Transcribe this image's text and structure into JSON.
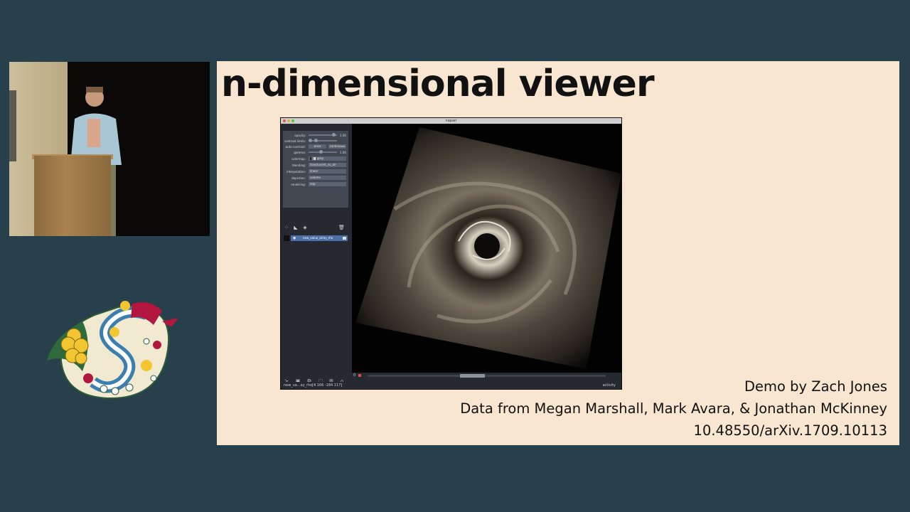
{
  "slide": {
    "title": "n-dimensional viewer",
    "credits": [
      "Demo by Zach Jones",
      "Data from Megan Marshall, Mark Avara, & Jonathan McKinney",
      "10.48550/arXiv.1709.10113"
    ]
  },
  "napari": {
    "window_title": "napari",
    "controls": {
      "opacity_label": "opacity:",
      "opacity_value": "1.00",
      "opacity_level": 0.95,
      "contrast_label": "contrast limits:",
      "auto_contrast_label": "auto-contrast:",
      "once_label": "once",
      "continuous_label": "continuous",
      "gamma_label": "gamma:",
      "gamma_value": "1.00",
      "colormap_label": "colormap:",
      "colormap_value": "gray",
      "blending_label": "blending:",
      "blending_value": "translucent_no_de",
      "interpolation_label": "interpolation:",
      "interpolation_value": "linear",
      "depiction_label": "depiction:",
      "depiction_value": "volume",
      "rendering_label": "rendering:",
      "rendering_value": "mip"
    },
    "layer_name": "new_value_array_rho",
    "status_layer": "new_va...ay_rho",
    "status_coords": "[4 166 -184 117]",
    "activity_label": "activity"
  },
  "colors": {
    "background": "#27404c",
    "slide_bg": "#f9e6d0",
    "napari_panel": "#262930",
    "napari_controls": "#414851",
    "napari_selected": "#4d6fa8"
  }
}
